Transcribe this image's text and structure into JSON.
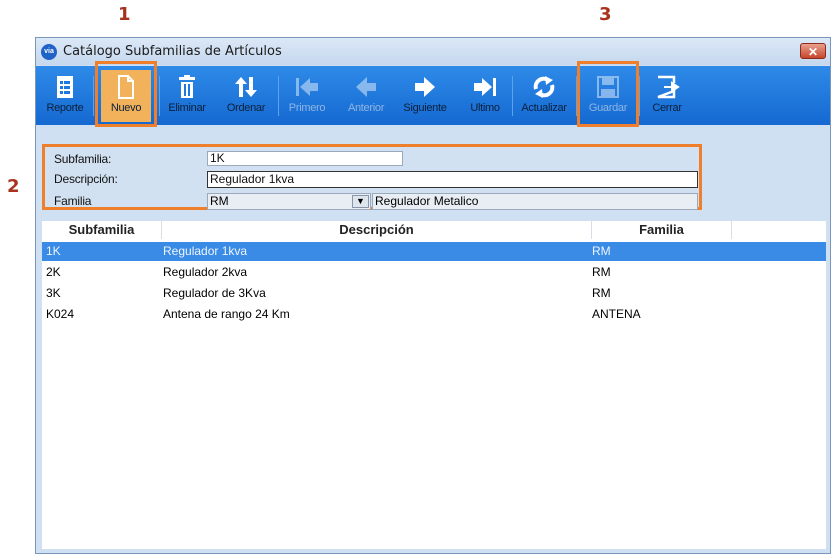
{
  "annotations": {
    "one": "1",
    "two": "2",
    "three": "3"
  },
  "window": {
    "logo_text": "via",
    "title": "Catálogo Subfamilias de Artículos",
    "close_glyph": "✕"
  },
  "toolbar": {
    "reporte": "Reporte",
    "nuevo": "Nuevo",
    "eliminar": "Eliminar",
    "ordenar": "Ordenar",
    "primero": "Primero",
    "anterior": "Anterior",
    "siguiente": "Siguiente",
    "ultimo": "Ultimo",
    "actualizar": "Actualizar",
    "guardar": "Guardar",
    "cerrar": "Cerrar"
  },
  "form": {
    "subfamilia_label": "Subfamilia:",
    "subfamilia_value": "1K",
    "descripcion_label": "Descripción:",
    "descripcion_value": "Regulador 1kva",
    "familia_label": "Familia",
    "familia_value": "RM",
    "familia_description": "Regulador Metalico"
  },
  "grid": {
    "headers": {
      "subfamilia": "Subfamilia",
      "descripcion": "Descripción",
      "familia": "Familia"
    },
    "rows": [
      {
        "subfamilia": "1K",
        "descripcion": "Regulador 1kva",
        "familia": "RM"
      },
      {
        "subfamilia": "2K",
        "descripcion": "Regulador 2kva",
        "familia": "RM"
      },
      {
        "subfamilia": "3K",
        "descripcion": "Regulador de 3Kva",
        "familia": "RM"
      },
      {
        "subfamilia": "K024",
        "descripcion": "Antena de rango 24 Km",
        "familia": "ANTENA"
      }
    ]
  },
  "colors": {
    "highlight": "#ef7f2a",
    "toolbar": "#1e78de",
    "selected_row": "#3a8be6",
    "callout": "#a9321f"
  }
}
